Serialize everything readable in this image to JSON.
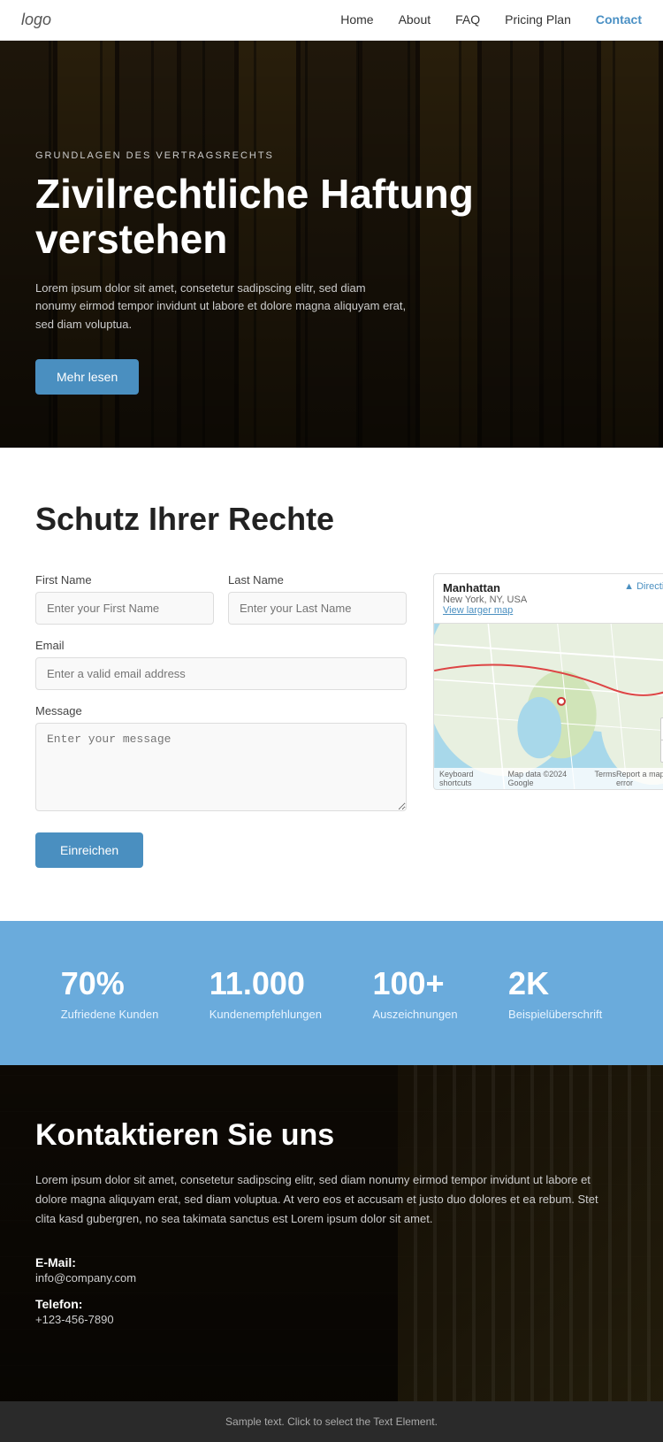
{
  "nav": {
    "logo": "logo",
    "links": [
      {
        "label": "Home",
        "href": "#",
        "active": false
      },
      {
        "label": "About",
        "href": "#",
        "active": false
      },
      {
        "label": "FAQ",
        "href": "#",
        "active": false
      },
      {
        "label": "Pricing Plan",
        "href": "#",
        "active": false
      },
      {
        "label": "Contact",
        "href": "#",
        "active": true
      }
    ]
  },
  "hero": {
    "subtitle": "GRUNDLAGEN DES VERTRAGSRECHTS",
    "title": "Zivilrechtliche Haftung verstehen",
    "description": "Lorem ipsum dolor sit amet, consetetur sadipscing elitr, sed diam nonumy eirmod tempor invidunt ut labore et dolore magna aliquyam erat, sed diam voluptua.",
    "button_label": "Mehr lesen"
  },
  "contact_section": {
    "title": "Schutz Ihrer Rechte",
    "form": {
      "first_name_label": "First Name",
      "first_name_placeholder": "Enter your First Name",
      "last_name_label": "Last Name",
      "last_name_placeholder": "Enter your Last Name",
      "email_label": "Email",
      "email_placeholder": "Enter a valid email address",
      "message_label": "Message",
      "message_placeholder": "Enter your message",
      "submit_label": "Einreichen"
    },
    "map": {
      "location_name": "Manhattan",
      "location_sub": "New York, NY, USA",
      "directions_label": "Directions",
      "view_larger_label": "View larger map",
      "footer_keyboard": "Keyboard shortcuts",
      "footer_map_data": "Map data ©2024 Google",
      "footer_terms": "Terms",
      "footer_report": "Report a map error"
    }
  },
  "stats": [
    {
      "number": "70%",
      "label": "Zufriedene Kunden"
    },
    {
      "number": "11.000",
      "label": "Kundenempfehlungen"
    },
    {
      "number": "100+",
      "label": "Auszeichnungen"
    },
    {
      "number": "2K",
      "label": "Beispielüberschrift"
    }
  ],
  "contact_info": {
    "title": "Kontaktieren Sie uns",
    "description": "Lorem ipsum dolor sit amet, consetetur sadipscing elitr, sed diam nonumy eirmod tempor invidunt ut labore et dolore magna aliquyam erat, sed diam voluptua. At vero eos et accusam et justo duo dolores et ea rebum. Stet clita kasd gubergren, no sea takimata sanctus est Lorem ipsum dolor sit amet.",
    "email_label": "E-Mail:",
    "email_value": "info@company.com",
    "phone_label": "Telefon:",
    "phone_value": "+123-456-7890"
  },
  "footer": {
    "text": "Sample text. Click to select the Text Element."
  }
}
